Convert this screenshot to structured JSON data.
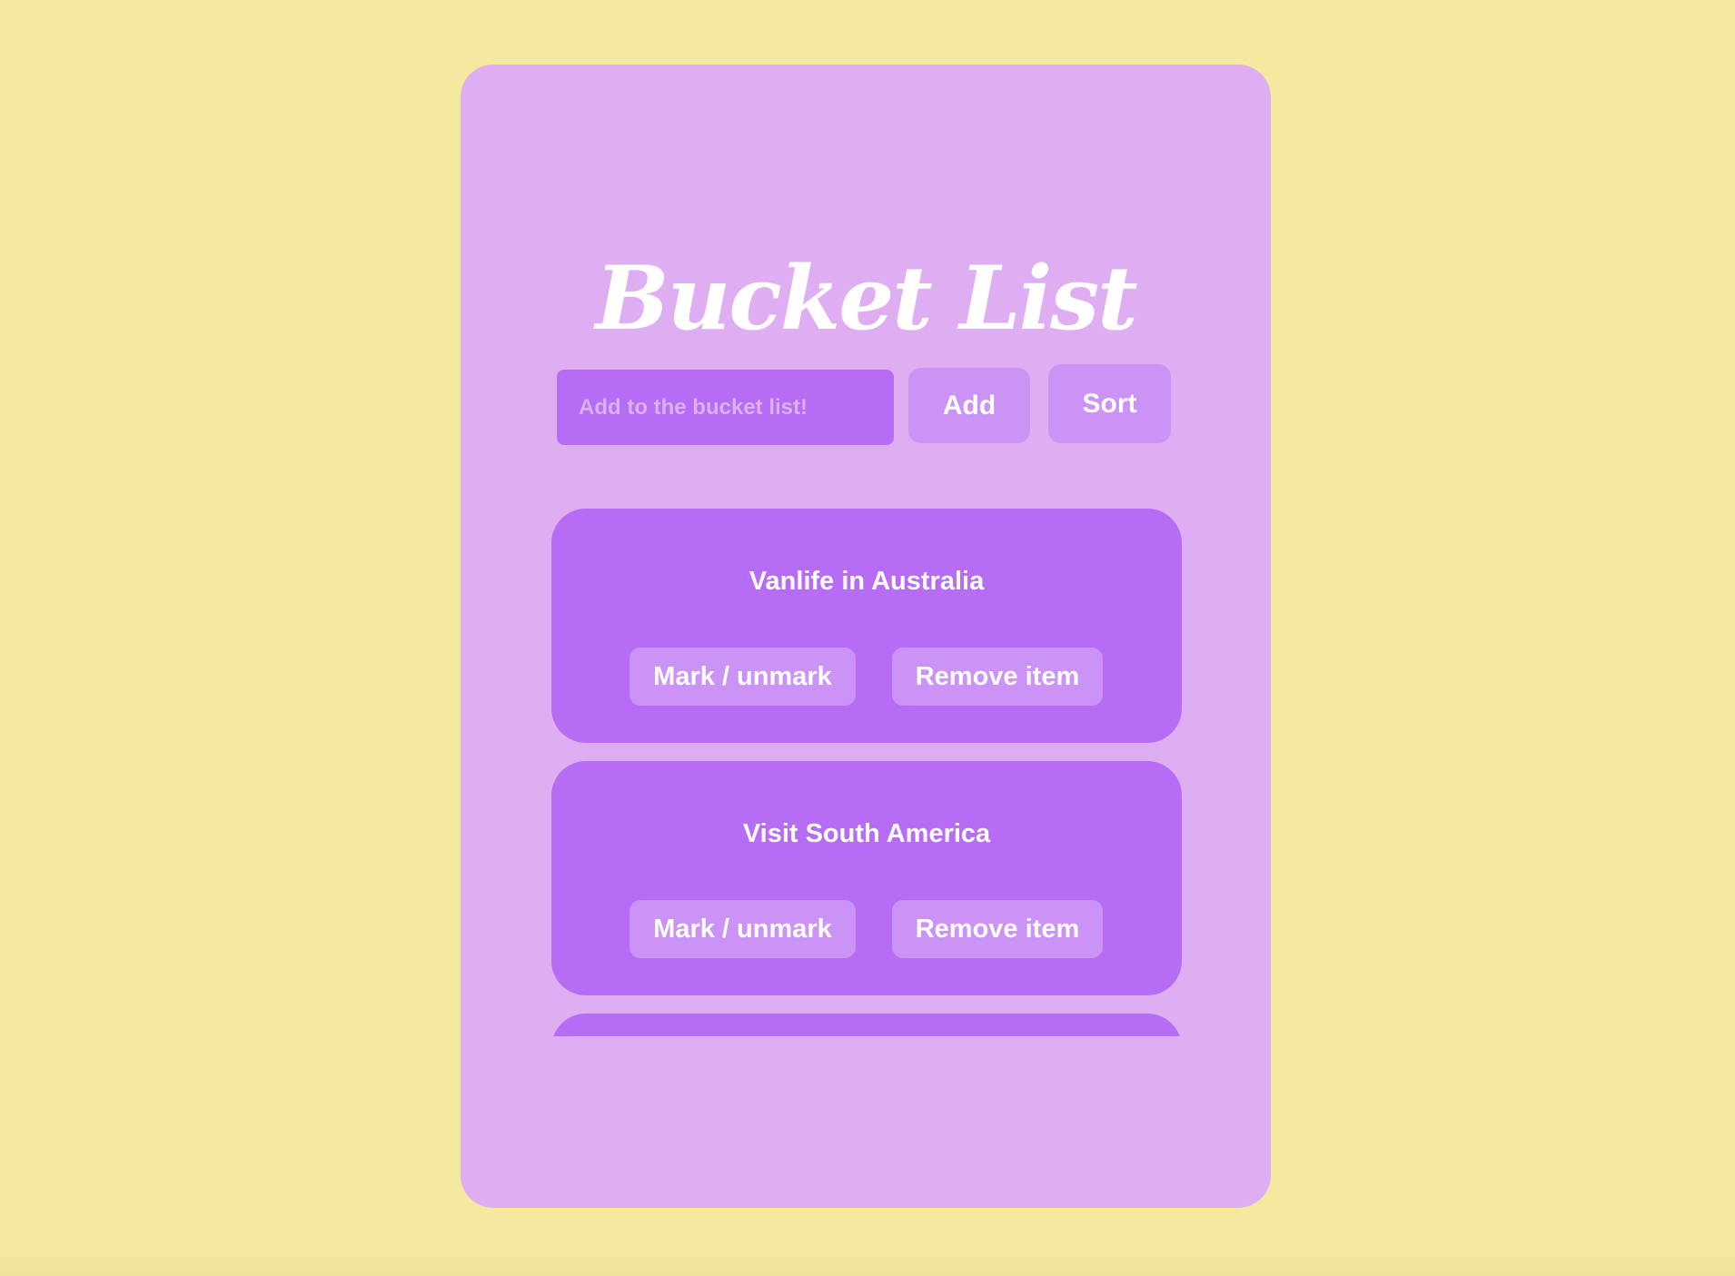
{
  "header": {
    "title": "Bucket List"
  },
  "form": {
    "placeholder": "Add to the bucket list!",
    "value": "",
    "add_label": "Add",
    "sort_label": "Sort"
  },
  "items": [
    {
      "text": "Vanlife in Australia",
      "mark_label": "Mark / unmark",
      "remove_label": "Remove item"
    },
    {
      "text": "Visit South America",
      "mark_label": "Mark / unmark",
      "remove_label": "Remove item"
    },
    {
      "text": "",
      "mark_label": "",
      "remove_label": ""
    }
  ],
  "colors": {
    "background": "#f5e9a0",
    "card": "#deadf2",
    "accent": "#b66cf5",
    "button": "#cb93f6",
    "text": "#ffffff"
  }
}
